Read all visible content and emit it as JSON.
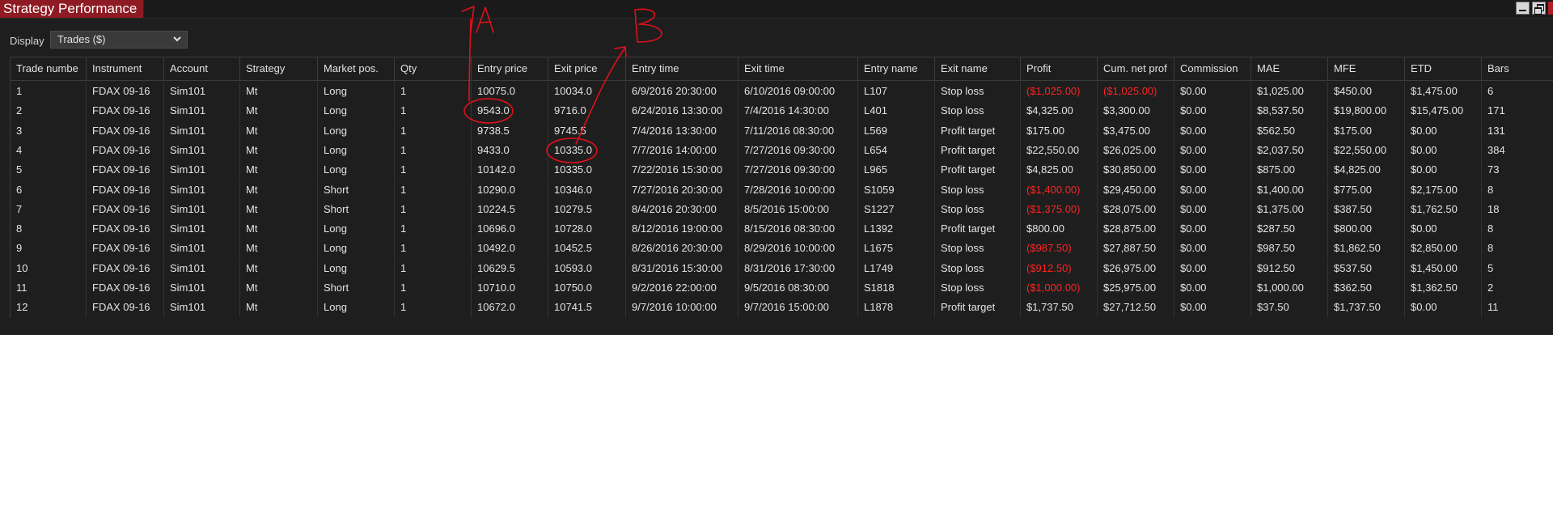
{
  "window": {
    "title": "Strategy Performance"
  },
  "toolbar": {
    "display_label": "Display",
    "display_value": "Trades ($)"
  },
  "grid": {
    "columns": [
      "Trade numbe",
      "Instrument",
      "Account",
      "Strategy",
      "Market pos.",
      "Qty",
      "Entry price",
      "Exit price",
      "Entry time",
      "Exit time",
      "Entry name",
      "Exit name",
      "Profit",
      "Cum. net prof",
      "Commission",
      "MAE",
      "MFE",
      "ETD",
      "Bars"
    ],
    "rows": [
      [
        "1",
        "FDAX 09-16",
        "Sim101",
        "Mt",
        "Long",
        "1",
        "10075.0",
        "10034.0",
        "6/9/2016 20:30:00",
        "6/10/2016 09:00:00",
        "L107",
        "Stop loss",
        "($1,025.00)",
        "($1,025.00)",
        "$0.00",
        "$1,025.00",
        "$450.00",
        "$1,475.00",
        "6"
      ],
      [
        "2",
        "FDAX 09-16",
        "Sim101",
        "Mt",
        "Long",
        "1",
        "9543.0",
        "9716.0",
        "6/24/2016 13:30:00",
        "7/4/2016 14:30:00",
        "L401",
        "Stop loss",
        "$4,325.00",
        "$3,300.00",
        "$0.00",
        "$8,537.50",
        "$19,800.00",
        "$15,475.00",
        "171"
      ],
      [
        "3",
        "FDAX 09-16",
        "Sim101",
        "Mt",
        "Long",
        "1",
        "9738.5",
        "9745.5",
        "7/4/2016 13:30:00",
        "7/11/2016 08:30:00",
        "L569",
        "Profit target",
        "$175.00",
        "$3,475.00",
        "$0.00",
        "$562.50",
        "$175.00",
        "$0.00",
        "131"
      ],
      [
        "4",
        "FDAX 09-16",
        "Sim101",
        "Mt",
        "Long",
        "1",
        "9433.0",
        "10335.0",
        "7/7/2016 14:00:00",
        "7/27/2016 09:30:00",
        "L654",
        "Profit target",
        "$22,550.00",
        "$26,025.00",
        "$0.00",
        "$2,037.50",
        "$22,550.00",
        "$0.00",
        "384"
      ],
      [
        "5",
        "FDAX 09-16",
        "Sim101",
        "Mt",
        "Long",
        "1",
        "10142.0",
        "10335.0",
        "7/22/2016 15:30:00",
        "7/27/2016 09:30:00",
        "L965",
        "Profit target",
        "$4,825.00",
        "$30,850.00",
        "$0.00",
        "$875.00",
        "$4,825.00",
        "$0.00",
        "73"
      ],
      [
        "6",
        "FDAX 09-16",
        "Sim101",
        "Mt",
        "Short",
        "1",
        "10290.0",
        "10346.0",
        "7/27/2016 20:30:00",
        "7/28/2016 10:00:00",
        "S1059",
        "Stop loss",
        "($1,400.00)",
        "$29,450.00",
        "$0.00",
        "$1,400.00",
        "$775.00",
        "$2,175.00",
        "8"
      ],
      [
        "7",
        "FDAX 09-16",
        "Sim101",
        "Mt",
        "Short",
        "1",
        "10224.5",
        "10279.5",
        "8/4/2016 20:30:00",
        "8/5/2016 15:00:00",
        "S1227",
        "Stop loss",
        "($1,375.00)",
        "$28,075.00",
        "$0.00",
        "$1,375.00",
        "$387.50",
        "$1,762.50",
        "18"
      ],
      [
        "8",
        "FDAX 09-16",
        "Sim101",
        "Mt",
        "Long",
        "1",
        "10696.0",
        "10728.0",
        "8/12/2016 19:00:00",
        "8/15/2016 08:30:00",
        "L1392",
        "Profit target",
        "$800.00",
        "$28,875.00",
        "$0.00",
        "$287.50",
        "$800.00",
        "$0.00",
        "8"
      ],
      [
        "9",
        "FDAX 09-16",
        "Sim101",
        "Mt",
        "Long",
        "1",
        "10492.0",
        "10452.5",
        "8/26/2016 20:30:00",
        "8/29/2016 10:00:00",
        "L1675",
        "Stop loss",
        "($987.50)",
        "$27,887.50",
        "$0.00",
        "$987.50",
        "$1,862.50",
        "$2,850.00",
        "8"
      ],
      [
        "10",
        "FDAX 09-16",
        "Sim101",
        "Mt",
        "Long",
        "1",
        "10629.5",
        "10593.0",
        "8/31/2016 15:30:00",
        "8/31/2016 17:30:00",
        "L1749",
        "Stop loss",
        "($912.50)",
        "$26,975.00",
        "$0.00",
        "$912.50",
        "$537.50",
        "$1,450.00",
        "5"
      ],
      [
        "11",
        "FDAX 09-16",
        "Sim101",
        "Mt",
        "Short",
        "1",
        "10710.0",
        "10750.0",
        "9/2/2016 22:00:00",
        "9/5/2016 08:30:00",
        "S1818",
        "Stop loss",
        "($1,000.00)",
        "$25,975.00",
        "$0.00",
        "$1,000.00",
        "$362.50",
        "$1,362.50",
        "2"
      ],
      [
        "12",
        "FDAX 09-16",
        "Sim101",
        "Mt",
        "Long",
        "1",
        "10672.0",
        "10741.5",
        "9/7/2016 10:00:00",
        "9/7/2016 15:00:00",
        "L1878",
        "Profit target",
        "$1,737.50",
        "$27,712.50",
        "$0.00",
        "$37.50",
        "$1,737.50",
        "$0.00",
        "11"
      ]
    ]
  },
  "annotations": {
    "label_a": "1A",
    "label_b": "B",
    "color": "#e0101a"
  },
  "colors": {
    "title_tab": "#8e1b23",
    "negative": "#ff2323",
    "background": "#1e1e1e"
  }
}
